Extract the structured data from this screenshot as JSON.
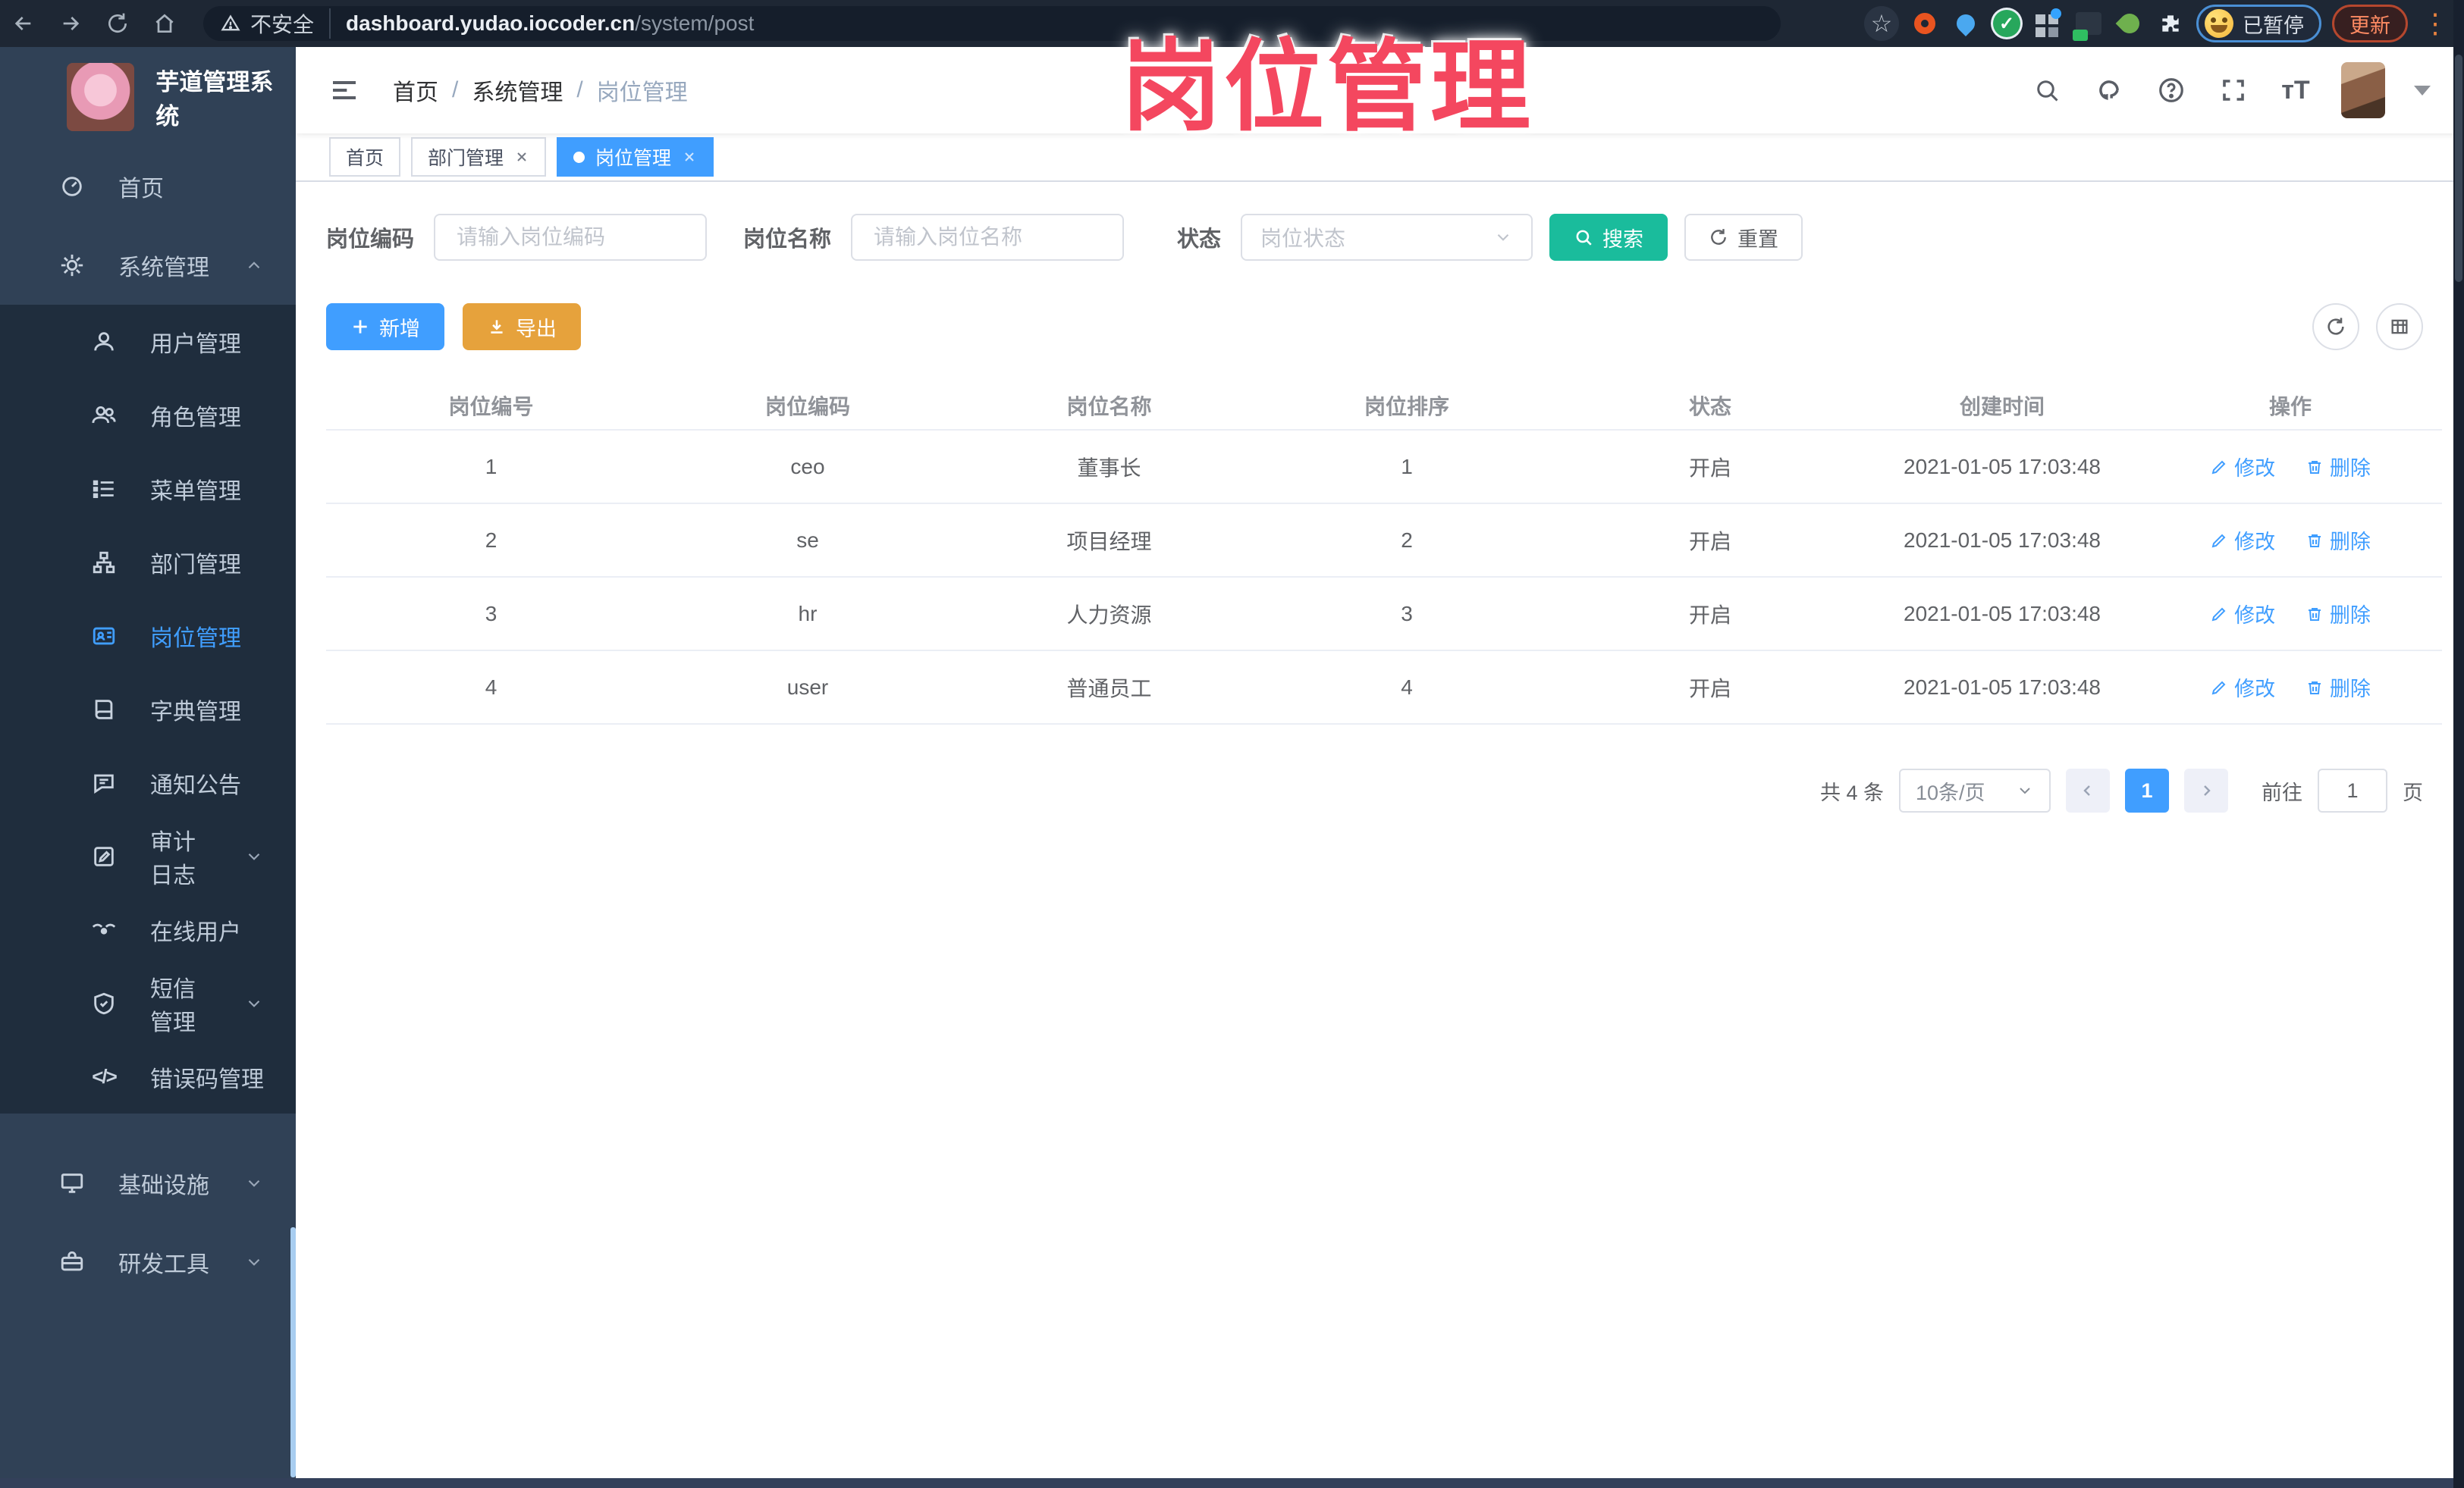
{
  "browser": {
    "security_label": "不安全",
    "url_domain": "dashboard.yudao.iocoder.cn",
    "url_path": "/system/post",
    "paused_label": "已暂停",
    "update_label": "更新"
  },
  "watermark": "岗位管理",
  "sidebar": {
    "app_title": "芋道管理系统",
    "menu": [
      {
        "label": "首页",
        "icon": "dashboard-icon"
      },
      {
        "label": "系统管理",
        "icon": "gear-icon"
      }
    ],
    "submenu": [
      {
        "label": "用户管理",
        "icon": "user-icon"
      },
      {
        "label": "角色管理",
        "icon": "users-icon"
      },
      {
        "label": "菜单管理",
        "icon": "menu-list-icon"
      },
      {
        "label": "部门管理",
        "icon": "org-tree-icon"
      },
      {
        "label": "岗位管理",
        "icon": "id-card-icon"
      },
      {
        "label": "字典管理",
        "icon": "dictionary-icon"
      },
      {
        "label": "通知公告",
        "icon": "announcement-icon"
      },
      {
        "label": "审计日志",
        "icon": "audit-log-icon"
      },
      {
        "label": "在线用户",
        "icon": "online-users-icon"
      },
      {
        "label": "短信管理",
        "icon": "sms-shield-icon"
      },
      {
        "label": "错误码管理",
        "icon": "code-icon",
        "glyph": "</>"
      }
    ],
    "bottom": [
      {
        "label": "基础设施",
        "icon": "infrastructure-icon"
      },
      {
        "label": "研发工具",
        "icon": "dev-tools-icon"
      }
    ]
  },
  "navbar": {
    "breadcrumb": [
      "首页",
      "系统管理",
      "岗位管理"
    ],
    "separator": "/"
  },
  "tabs": [
    {
      "label": "首页"
    },
    {
      "label": "部门管理"
    },
    {
      "label": "岗位管理"
    }
  ],
  "filters": {
    "code_label": "岗位编码",
    "code_placeholder": "请输入岗位编码",
    "name_label": "岗位名称",
    "name_placeholder": "请输入岗位名称",
    "status_label": "状态",
    "status_placeholder": "岗位状态",
    "search_label": "搜索",
    "reset_label": "重置"
  },
  "toolbar": {
    "add_label": "新增",
    "export_label": "导出"
  },
  "table": {
    "columns": [
      "岗位编号",
      "岗位编码",
      "岗位名称",
      "岗位排序",
      "状态",
      "创建时间",
      "操作"
    ],
    "edit_label": "修改",
    "delete_label": "删除",
    "rows": [
      {
        "id": "1",
        "code": "ceo",
        "name": "董事长",
        "sort": "1",
        "status": "开启",
        "created": "2021-01-05 17:03:48"
      },
      {
        "id": "2",
        "code": "se",
        "name": "项目经理",
        "sort": "2",
        "status": "开启",
        "created": "2021-01-05 17:03:48"
      },
      {
        "id": "3",
        "code": "hr",
        "name": "人力资源",
        "sort": "3",
        "status": "开启",
        "created": "2021-01-05 17:03:48"
      },
      {
        "id": "4",
        "code": "user",
        "name": "普通员工",
        "sort": "4",
        "status": "开启",
        "created": "2021-01-05 17:03:48"
      }
    ]
  },
  "pagination": {
    "total_label": "共 4 条",
    "page_size_label": "10条/页",
    "page": "1",
    "goto_label": "前往",
    "goto_value": "1",
    "page_unit_label": "页"
  },
  "colors": {
    "primary": "#409EFF",
    "warning": "#E6A23C",
    "search_teal": "#1ABC9C",
    "sidebar_bg": "#304156",
    "submenu_bg": "#1F2D3D",
    "watermark_pink": "#F4475F"
  }
}
